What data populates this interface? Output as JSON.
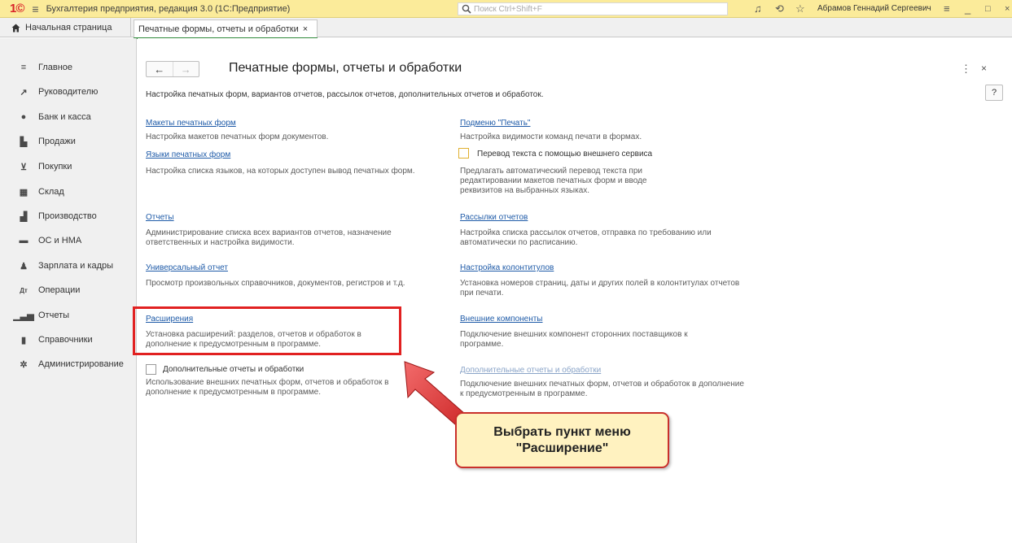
{
  "window": {
    "app_title": "Бухгалтерия предприятия, редакция 3.0  (1С:Предприятие)",
    "search_placeholder": "Поиск Ctrl+Shift+F",
    "user_name": "Абрамов Геннадий Сергеевич"
  },
  "tabs": {
    "home_label": "Начальная страница",
    "current_label": "Печатные формы, отчеты и обработки",
    "close_glyph": "×"
  },
  "sidebar": {
    "items": [
      {
        "label": "Главное",
        "icon": "menu-lines-icon"
      },
      {
        "label": "Руководителю",
        "icon": "trend-icon"
      },
      {
        "label": "Банк и касса",
        "icon": "coin-icon"
      },
      {
        "label": "Продажи",
        "icon": "bag-icon"
      },
      {
        "label": "Покупки",
        "icon": "cart-icon"
      },
      {
        "label": "Склад",
        "icon": "warehouse-icon"
      },
      {
        "label": "Производство",
        "icon": "factory-icon"
      },
      {
        "label": "ОС и НМА",
        "icon": "truck-icon"
      },
      {
        "label": "Зарплата и кадры",
        "icon": "person-icon"
      },
      {
        "label": "Операции",
        "icon": "dt-kt-icon"
      },
      {
        "label": "Отчеты",
        "icon": "bar-chart-icon"
      },
      {
        "label": "Справочники",
        "icon": "book-icon"
      },
      {
        "label": "Администрирование",
        "icon": "gear-icon"
      }
    ]
  },
  "page": {
    "title": "Печатные формы, отчеты и обработки",
    "description": "Настройка печатных форм, вариантов отчетов, рассылок отчетов, дополнительных отчетов и обработок.",
    "help": "?"
  },
  "left": [
    {
      "link": "Макеты печатных форм",
      "desc": "Настройка макетов печатных форм документов."
    },
    {
      "link": "Языки печатных форм",
      "desc": "Настройка списка языков, на которых доступен вывод печатных форм."
    },
    {
      "link": "Отчеты",
      "desc": "Администрирование списка всех вариантов отчетов, назначение ответственных и настройка видимости."
    },
    {
      "link": "Универсальный отчет",
      "desc": "Просмотр произвольных справочников, документов, регистров и т.д."
    },
    {
      "link": "Расширения",
      "desc": "Установка расширений: разделов, отчетов и обработок в дополнение к предусмотренным в программе."
    },
    {
      "checkbox": "Дополнительные отчеты и обработки",
      "desc": "Использование внешних печатных форм, отчетов и обработок в дополнение к предусмотренным в программе."
    }
  ],
  "right": [
    {
      "link": "Подменю \"Печать\"",
      "desc": "Настройка видимости команд печати в формах."
    },
    {
      "checkbox": "Перевод текста с помощью внешнего сервиса",
      "desc": "Предлагать автоматический перевод текста при редактировании макетов печатных форм и вводе реквизитов на выбранных языках."
    },
    {
      "link": "Рассылки отчетов",
      "desc": "Настройка списка рассылок отчетов, отправка по требованию или автоматически по расписанию."
    },
    {
      "link": "Настройка колонтитулов",
      "desc": "Установка номеров страниц, даты и других полей в колонтитулах отчетов при печати."
    },
    {
      "link": "Внешние компоненты",
      "desc": "Подключение внешних компонент сторонних поставщиков к программе."
    },
    {
      "link": "Дополнительные отчеты и обработки",
      "desc": "Подключение внешних печатных форм, отчетов и обработок в дополнение к предусмотренным в программе."
    }
  ],
  "annotation": {
    "callout_line1": "Выбрать пункт меню",
    "callout_line2": "\"Расширение\"",
    "highlight_color": "#e12121"
  }
}
